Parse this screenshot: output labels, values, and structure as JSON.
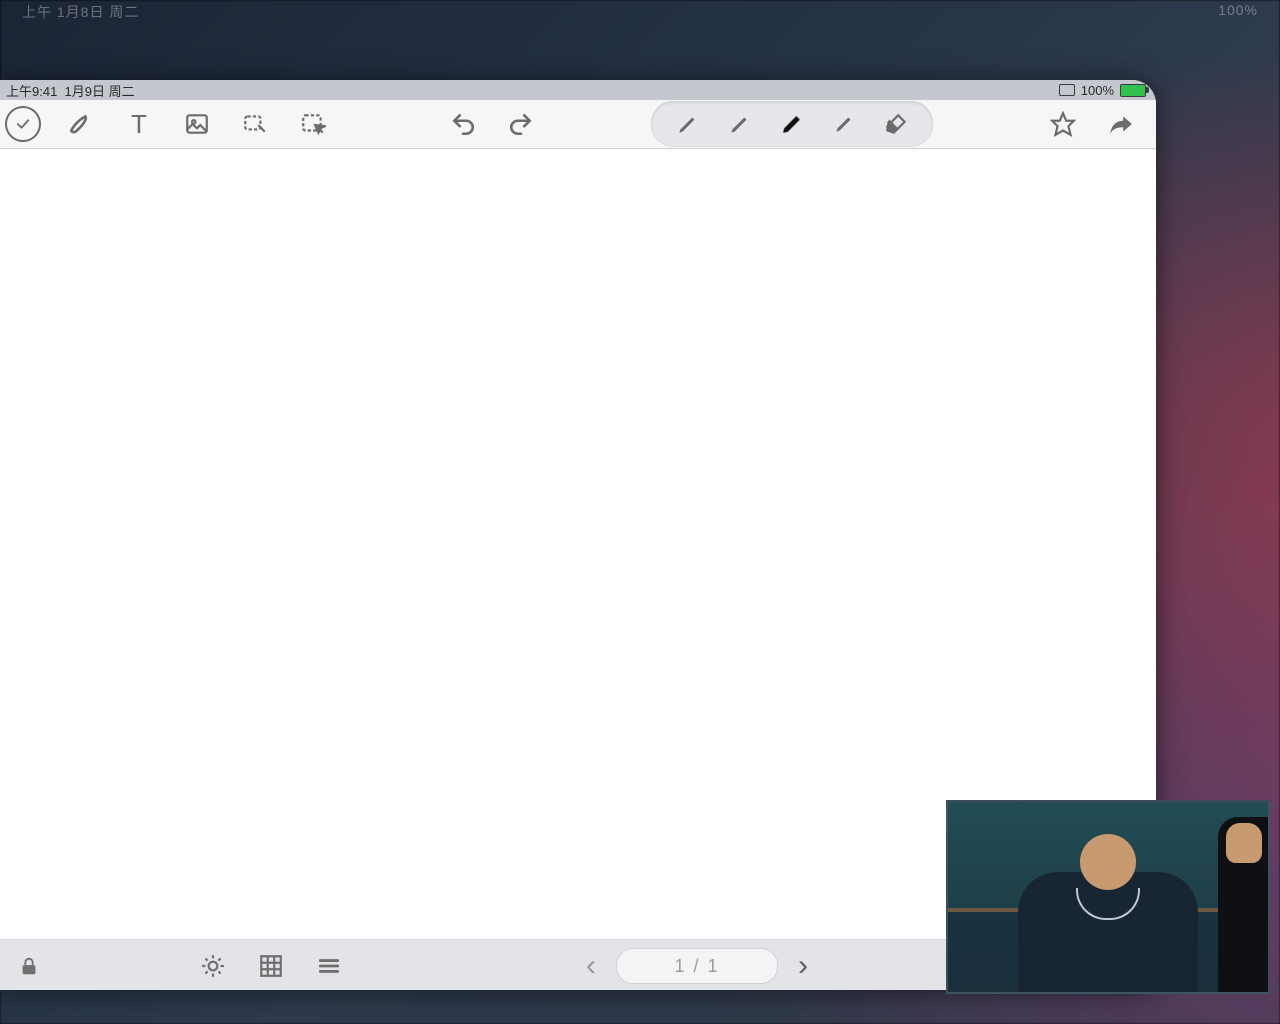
{
  "outer": {
    "left_faint": "上午 1月8日 周二",
    "right_faint": "100%"
  },
  "statusbar": {
    "time": "上午9:41",
    "date": "1月9日 周二",
    "battery_pct": "100%"
  },
  "toolbar": {
    "done": "完成",
    "pen": "画笔",
    "text": "T",
    "image": "图片",
    "lasso": "套索",
    "pointer": "选择",
    "undo": "撤销",
    "redo": "重做",
    "star": "收藏",
    "share": "分享"
  },
  "pen_tray": {
    "pen1": "钢笔",
    "pen2": "铅笔",
    "pen3_active": "毛笔",
    "highlighter": "荧光",
    "eraser": "橡皮"
  },
  "bottombar": {
    "lock": "锁定",
    "brightness": "亮度",
    "grid": "网格",
    "list": "列表",
    "prev": "‹",
    "next": "›",
    "wave": "页面"
  },
  "pager": {
    "current": 1,
    "total": 1,
    "text": "1 / 1"
  }
}
